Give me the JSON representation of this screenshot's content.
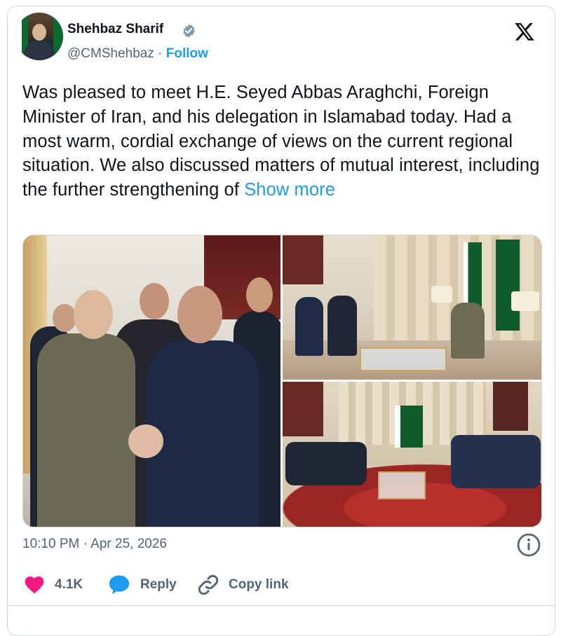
{
  "author": {
    "name": "Shehbaz Sharif",
    "handle": "@CMShehbaz",
    "separator": "·",
    "follow_label": "Follow"
  },
  "tweet": {
    "text": "Was pleased to meet H.E. Seyed Abbas Araghchi, Foreign Minister of Iran, and his delegation in Islamabad today. Had a most warm, cordial exchange of views on the current regional situation. We also discussed matters of mutual interest, including the further strengthening of",
    "show_more_label": "Show more"
  },
  "media": {
    "photo_count": 3
  },
  "meta": {
    "timestamp": "10:10 PM · Apr 25, 2026"
  },
  "actions": {
    "like_count": "4.1K",
    "reply_label": "Reply",
    "copy_link_label": "Copy link"
  },
  "colors": {
    "accent": "#1d9bf0",
    "like": "#f91880",
    "muted_text": "#536471",
    "border": "#cfd9de"
  },
  "icons": {
    "verified": "verified-badge-icon",
    "platform": "x-logo-icon",
    "info": "info-icon",
    "like": "heart-icon",
    "reply": "speech-bubble-icon",
    "copy": "link-icon"
  }
}
